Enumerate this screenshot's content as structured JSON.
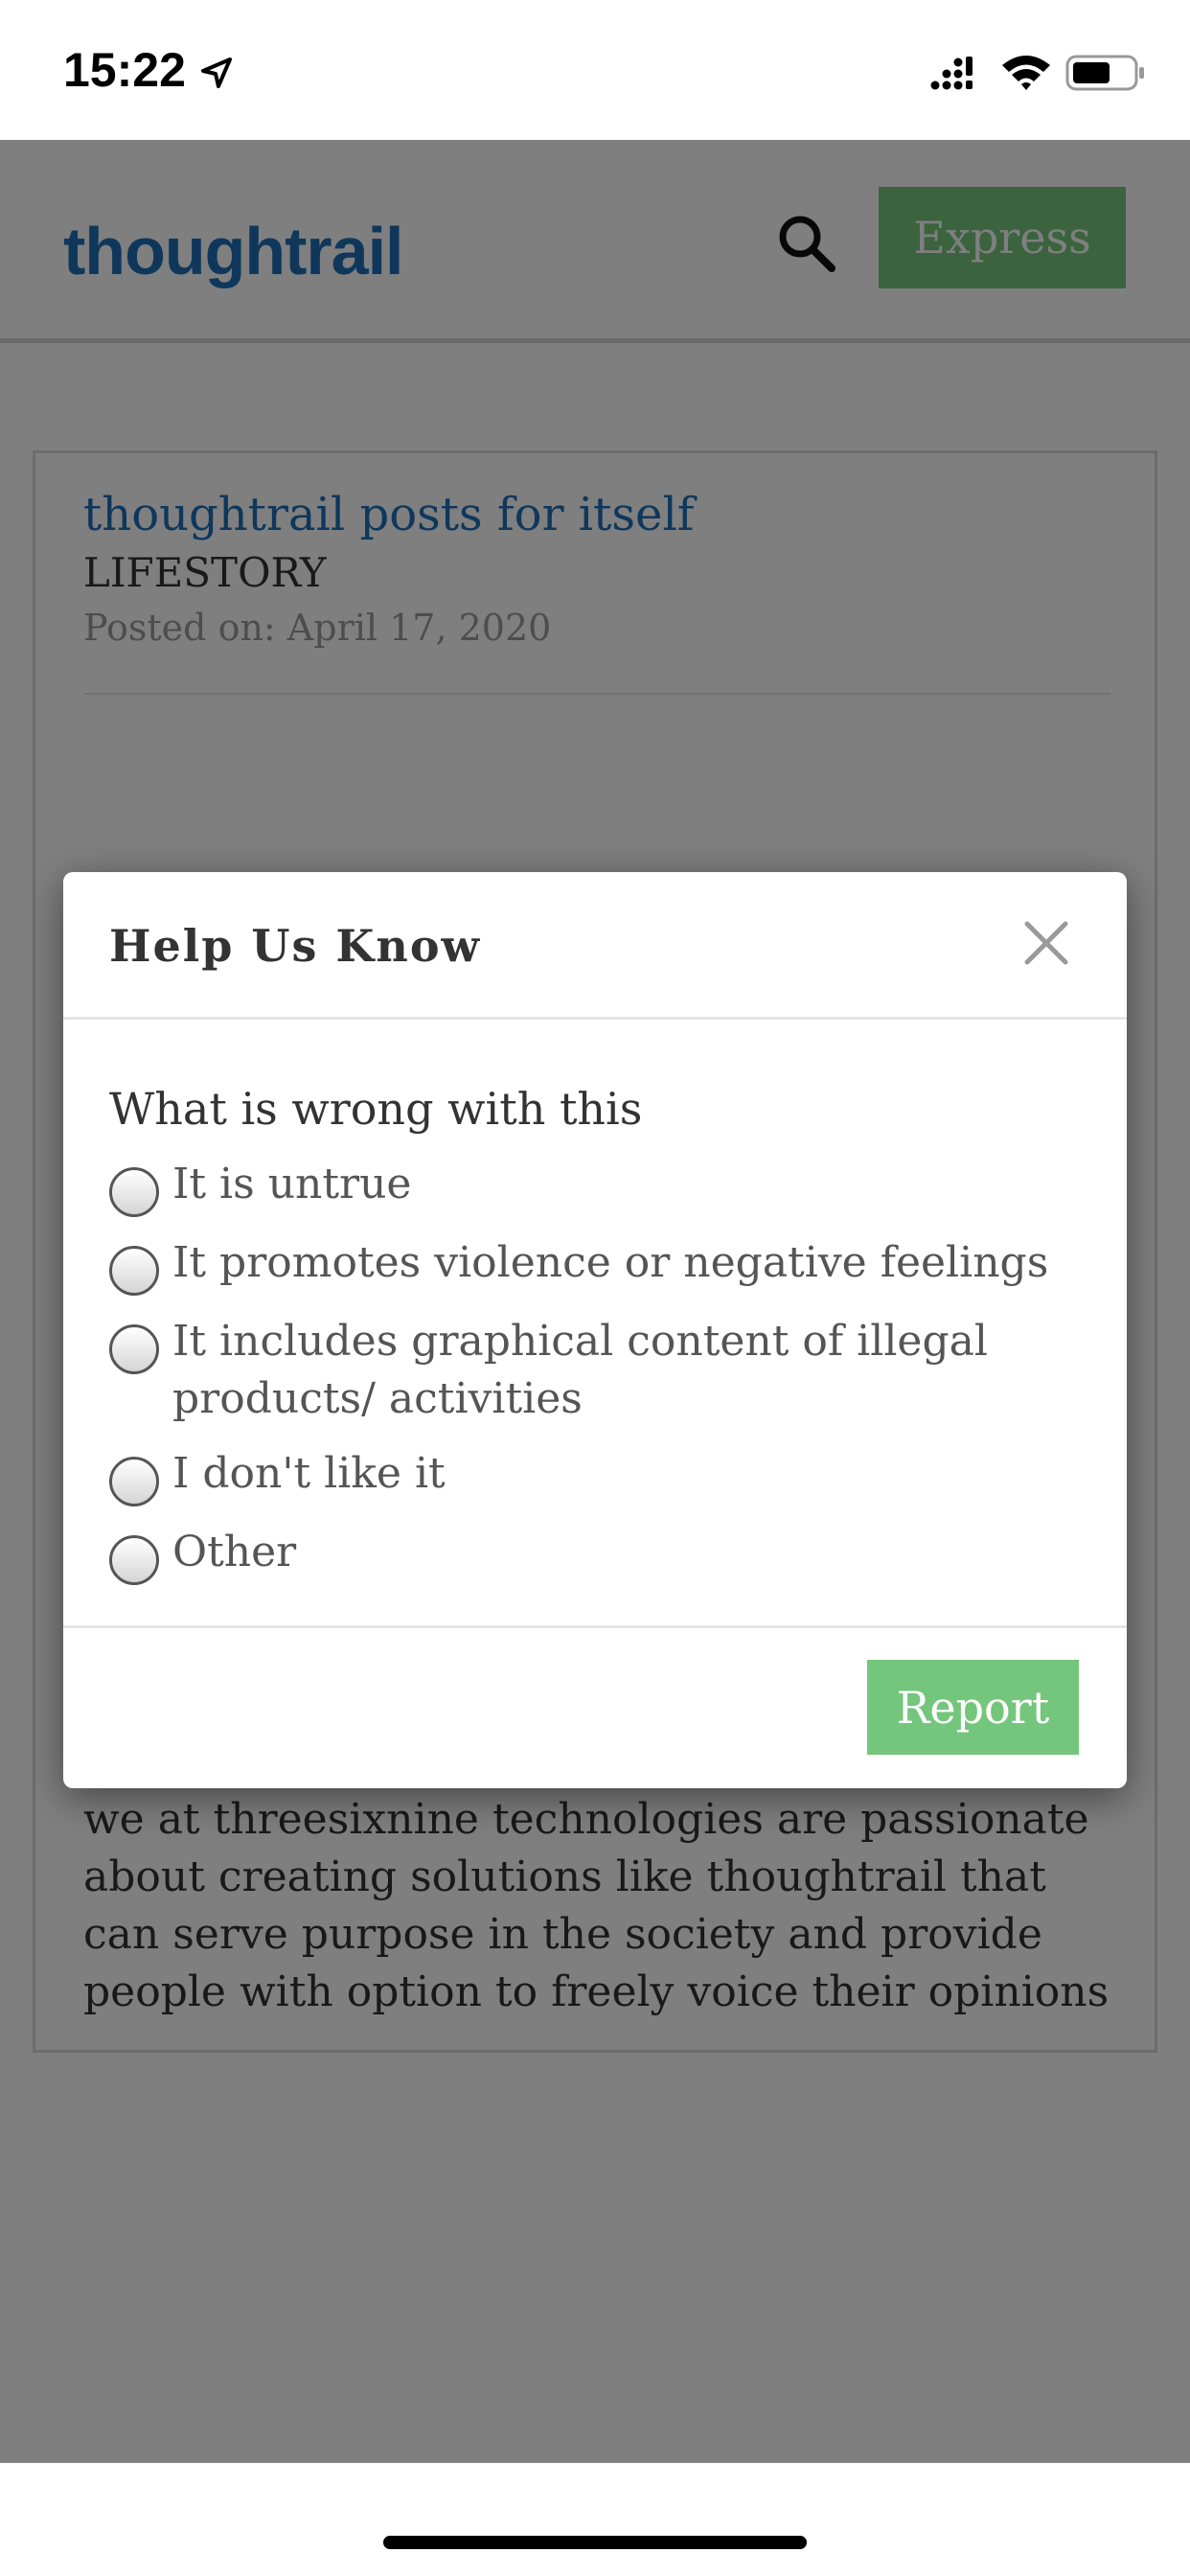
{
  "status_bar": {
    "time": "15:22"
  },
  "header": {
    "brand": "thoughtrail",
    "express_label": "Express"
  },
  "post": {
    "title": "thoughtrail posts for itself",
    "category": "LIFESTORY",
    "date": "Posted on: April 17, 2020",
    "body": "we at threesixnine technologies are passionate about creating solutions like thoughtrail that can serve purpose in the society and provide people with option to freely voice their opinions"
  },
  "modal": {
    "title": "Help Us Know",
    "question": "What is wrong with this",
    "options": [
      {
        "label": "It is untrue"
      },
      {
        "label": "It promotes violence or negative feelings"
      },
      {
        "label": "It includes graphical content of illegal products/ activities"
      },
      {
        "label": "I don't like it"
      },
      {
        "label": "Other"
      }
    ],
    "report_label": "Report"
  }
}
